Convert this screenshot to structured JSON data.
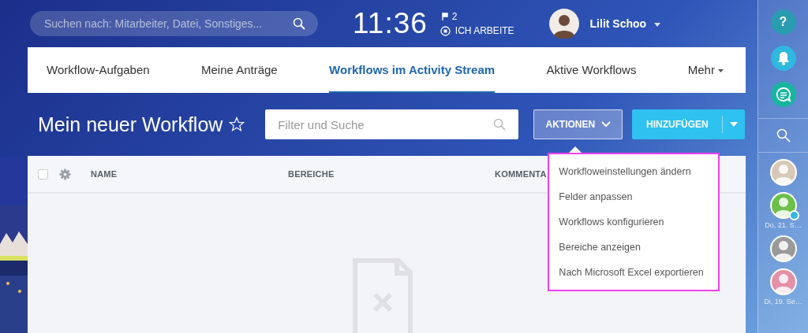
{
  "search": {
    "placeholder": "Suchen nach: Mitarbeiter, Datei, Sonstiges..."
  },
  "clock": {
    "time": "11:36",
    "flag_count": "2",
    "status": "ICH ARBEITE"
  },
  "user": {
    "name": "Lilit Schoo"
  },
  "tabs": [
    {
      "label": "Workflow-Aufgaben",
      "selected": false
    },
    {
      "label": "Meine Anträge",
      "selected": false
    },
    {
      "label": "Workflows im Activity Stream",
      "selected": true
    },
    {
      "label": "Aktive Workflows",
      "selected": false
    },
    {
      "label": "Mehr",
      "selected": false
    }
  ],
  "page": {
    "title": "Mein neuer Workflow",
    "favorite": false
  },
  "filter": {
    "placeholder": "Filter und Suche"
  },
  "actions_button": {
    "label": "AKTIONEN",
    "expanded": true
  },
  "add_button": {
    "label": "HINZUFÜGEN"
  },
  "table": {
    "all_checked": false,
    "columns": [
      "NAME",
      "BEREICHE",
      "KOMMENTA"
    ]
  },
  "menu": {
    "items": [
      "Workfloweinstellungen ändern",
      "Felder anpassen",
      "Workflows konfigurieren",
      "Bereiche anzeigen",
      "Nach Microsoft Excel exportieren"
    ]
  },
  "sidebar": {
    "buttons": [
      {
        "kind": "help",
        "label": "?"
      },
      {
        "kind": "bell"
      },
      {
        "kind": "chat"
      }
    ],
    "contacts": [
      {
        "color": "#d8c8b8",
        "badge": false
      },
      {
        "color": "#6cc04a",
        "badge": true,
        "date": "Do, 21. S…"
      },
      {
        "color": "#9a9a9a",
        "badge": false
      },
      {
        "color": "#e58fa8",
        "badge": false,
        "date": "Di, 19. Se…"
      }
    ]
  }
}
